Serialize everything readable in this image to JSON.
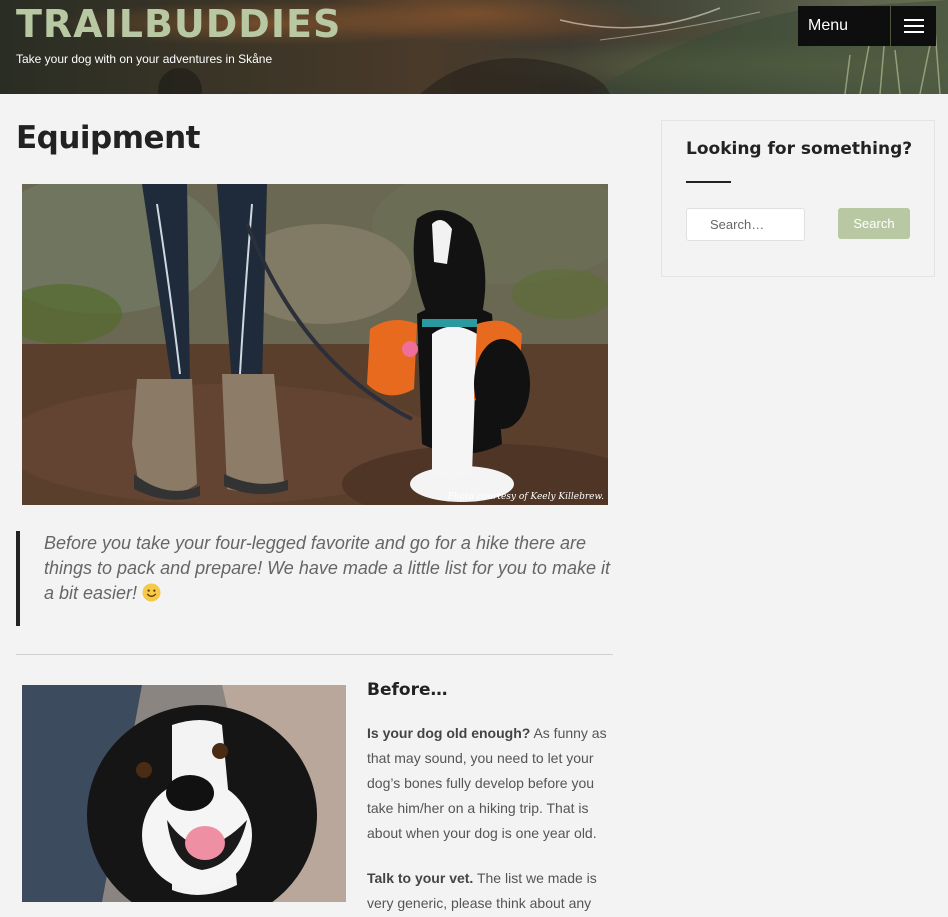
{
  "header": {
    "site_title": "TRAILBUDDIES",
    "tagline": "Take your dog with on your adventures in Skåne",
    "menu_label": "Menu",
    "menu_icon": "hamburger-icon"
  },
  "main": {
    "page_title": "Equipment",
    "hero_caption": "Photo courtesy of Keely Killebrew.",
    "intro_quote": "Before you take your four-legged favorite and go for a hike there are things to pack and prepare! We have made a little list for you to make it a bit easier!",
    "intro_emoji": "smiley-emoji-icon",
    "section_heading": "Before…",
    "paragraphs": [
      {
        "bold": "Is your dog old enough?",
        "text": " As funny as that may sound, you need to let your dog’s bones fully develop before you take him/her on a hiking trip. That is about when your dog is one year old."
      },
      {
        "bold": "Talk to your vet.",
        "text": " The list we made is very generic, please think about any"
      }
    ]
  },
  "sidebar": {
    "widget_title": "Looking for something?",
    "search_placeholder": "Search…",
    "search_button": "Search"
  },
  "colors": {
    "title_green": "#b8c8a3",
    "button_green": "#b7c8a3",
    "background": "#f3f3f3"
  }
}
